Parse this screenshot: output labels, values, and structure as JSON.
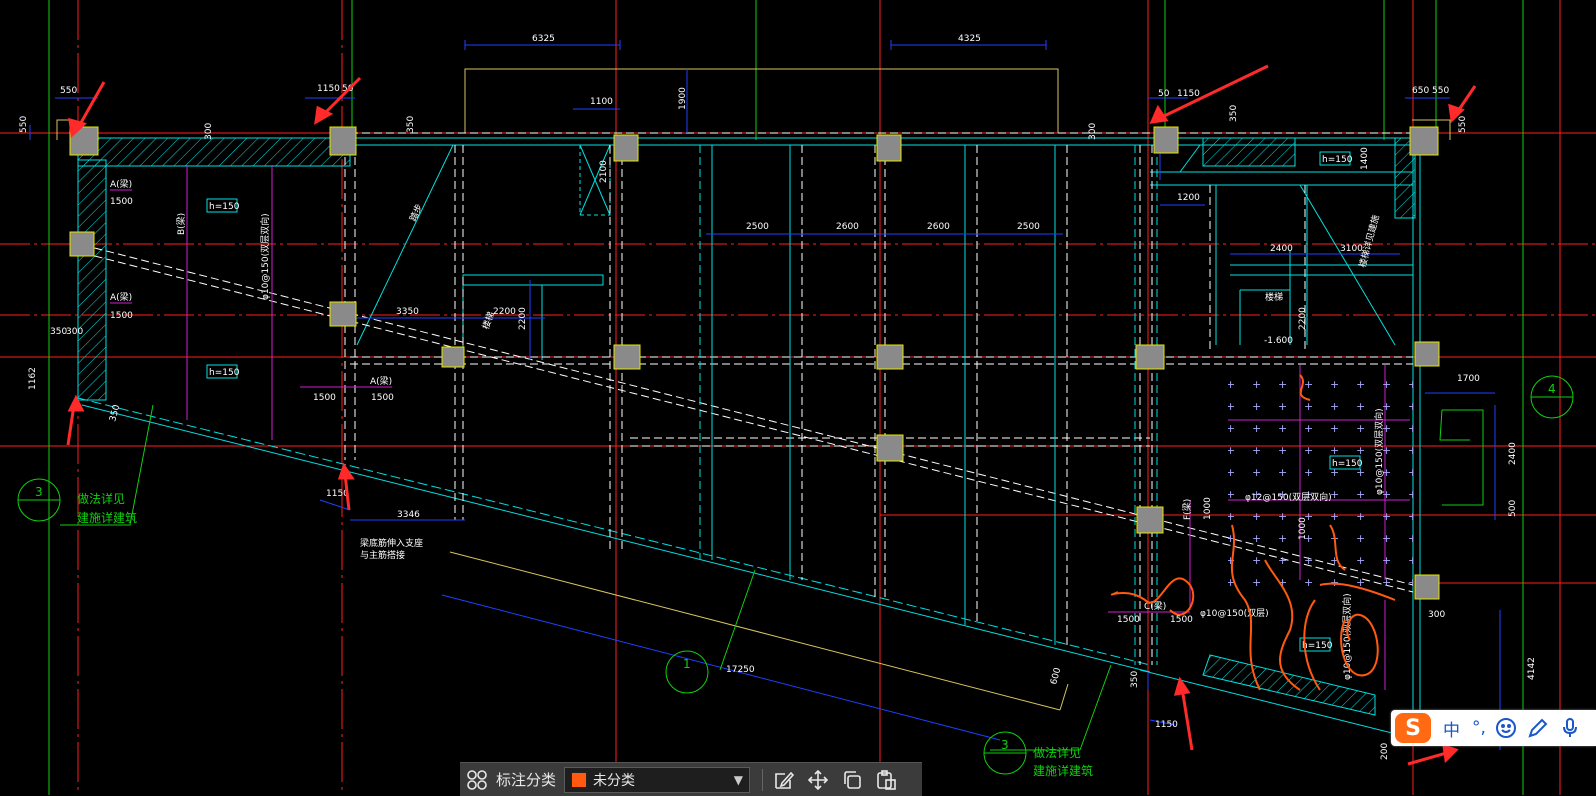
{
  "drawing": {
    "dimensions": {
      "d6325_left": "6325",
      "d6325_right": "4325",
      "d550_tl": "550",
      "d1150_tl": "1150",
      "d50_tl": "50",
      "d550_side": "550",
      "d300_a": "300",
      "d350_a": "350",
      "d1100": "1100",
      "d1900": "1900",
      "d300_b": "300",
      "d50_tr": "50",
      "d1150_tr": "1150",
      "d350_tr": "350",
      "d650": "650",
      "d550_tr": "550",
      "d550_tr_side": "550",
      "d1200_r": "1200",
      "d1400_r": "1400",
      "d2500_a": "2500",
      "d2600_a": "2600",
      "d2600_b": "2600",
      "d2500_b": "2500",
      "d2400": "2400",
      "d3100": "3100",
      "d3350": "3350",
      "d2200_a": "2200",
      "d2200_b": "2200",
      "d2100": "2100",
      "d2200_r": "2200",
      "d1500_a": "1500",
      "d1500_b": "1500",
      "d1500_c": "1500",
      "d1500_d": "1500",
      "d1500_e": "1500",
      "d1500_f": "1500",
      "d350_l": "350",
      "d300_l": "300",
      "d1162": "1162",
      "d350_bl": "350",
      "d1150_b": "1150",
      "d3346": "3346",
      "d17250": "17250",
      "d1700": "1700",
      "d2400_r": "2400",
      "d500_r": "500",
      "d4142": "4142",
      "d1150_br": "1150",
      "d350_br": "350",
      "d300_br": "300",
      "d200_br": "200",
      "d600": "600",
      "d1000_a": "1000",
      "d1000_b": "1000",
      "level": "-1.600"
    },
    "tags": {
      "h150_a": "h=150",
      "h150_b": "h=150",
      "h150_c": "h=150",
      "h150_d": "h=150",
      "h150_e": "h=150",
      "a_beam_1": "A(梁)",
      "a_beam_2": "A(梁)",
      "a_beam_3": "A(梁)",
      "b_beam": "B(梁)",
      "c_beam": "C(梁)",
      "f_beam": "F(梁)",
      "rebar_1": "φ10@150(双层双向)",
      "rebar_2": "φ12@150(双层双向)",
      "rebar_3": "φ10@150(双层)",
      "rebar_4": "φ10@150(双层双向)",
      "rebar_5": "φ10@150(双层双向)",
      "note_1": "梁底筋伸入支座",
      "note_2": "与主筋搭接",
      "note_3": "楼梯",
      "note_4": "楼梯",
      "note_5": "踏步",
      "note_6": "楼梯详见建施"
    },
    "circles": {
      "c3_left": "3",
      "c3_bottom": "3",
      "c1": "1",
      "c4": "4"
    },
    "callouts": {
      "left_line1": "做法详见",
      "left_line2": "建施详建筑",
      "bottom_line1": "做法详见",
      "bottom_line2": "建施详建筑"
    }
  },
  "toolbar": {
    "label": "标注分类",
    "select_value": "未分类"
  },
  "ime": {
    "logo": "S",
    "lang": "中",
    "punct": "°,"
  },
  "colors": {
    "background": "#000000",
    "axis_red": "#ff2020",
    "axis_green": "#10d010",
    "wall_cyan": "#00e0e0",
    "dashed_white": "#ffffff",
    "dimension_blue": "#2040ff",
    "magenta": "#d020d0",
    "column_fill": "#8a8a8a",
    "column_border": "#e6e600",
    "markup_orange": "#ff5a10",
    "arrow_red": "#ff2a2a"
  }
}
